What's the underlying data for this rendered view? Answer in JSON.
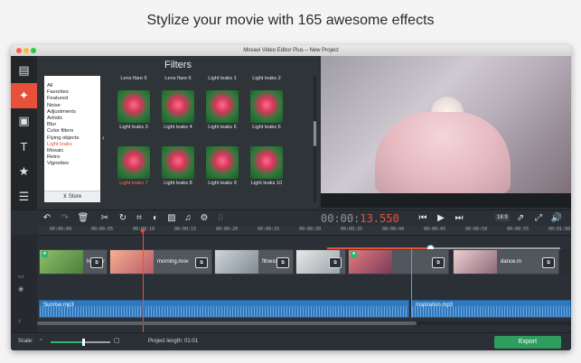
{
  "headline": "Stylize your movie with 165 awesome effects",
  "window_title": "Movavi Video Editor Plus – New Project",
  "filters": {
    "title": "Filters",
    "categories": [
      "All",
      "Favorites",
      "Featured",
      "Noise",
      "Adjustments",
      "Artistic",
      "Blur",
      "Color filters",
      "Flying objects",
      "Light leaks",
      "Mosaic",
      "Retro",
      "Vignettes"
    ],
    "selected_category": "Light leaks",
    "store_label": "Store",
    "top_labels": [
      "Lens flare 5",
      "Lens flare 6",
      "Light leaks 1",
      "Light leaks 2"
    ],
    "items": [
      "Light leaks 3",
      "Light leaks 4",
      "Light leaks 5",
      "Light leaks 6",
      "Light leaks 7",
      "Light leaks 8",
      "Light leaks 9",
      "Light leaks 10"
    ],
    "selected_item": "Light leaks 7"
  },
  "playback": {
    "timecode_dim": "00:00:",
    "timecode_live": "13.550",
    "aspect": "16:9",
    "progress": 0.44
  },
  "ruler_ticks": [
    "00:00:00",
    "00:00:05",
    "00:00:10",
    "00:00:15",
    "00:00:20",
    "00:00:25",
    "00:00:30",
    "00:00:35",
    "00:00:40",
    "00:00:45",
    "00:00:50",
    "00:00:55",
    "00:01:00"
  ],
  "video_clips": [
    {
      "name": "hd.mov"
    },
    {
      "name": "morning.mov"
    },
    {
      "name": "fitness.m"
    },
    {
      "name": ""
    },
    {
      "name": ""
    },
    {
      "name": "dance.m"
    }
  ],
  "audio_clips": [
    {
      "name": "Sunrise.mp3"
    },
    {
      "name": "Inspiration.mp3"
    }
  ],
  "bottom": {
    "scale_label": "Scale:",
    "project_length": "Project length:  01:01",
    "export_label": "Export",
    "scale_level": 0.55
  },
  "colors": {
    "accent": "#e9503a",
    "export_green": "#2e9e5f",
    "audio_blue": "#2f78bd"
  },
  "icons": {
    "rail": [
      "film-strip-icon",
      "magic-wand-icon",
      "clip-icon",
      "text-icon",
      "star-icon",
      "list-icon"
    ],
    "toolbar": [
      "undo-icon",
      "redo-icon",
      "trash-icon",
      "cut-icon",
      "rotate-icon",
      "crop-icon",
      "color-adjust-icon",
      "image-icon",
      "microphone-icon",
      "gear-icon",
      "grid-icon"
    ],
    "player": [
      "skip-back-icon",
      "play-icon",
      "skip-forward-icon",
      "detach-icon",
      "fullscreen-icon",
      "volume-icon"
    ]
  }
}
